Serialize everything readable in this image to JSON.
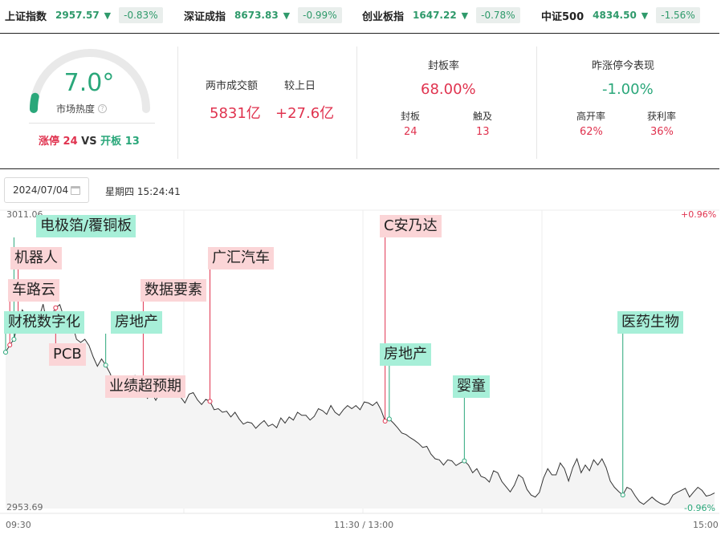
{
  "indices": [
    {
      "name": "上证指数",
      "value": "2957.57",
      "arrow": "▼",
      "pct": "-0.83%"
    },
    {
      "name": "深证成指",
      "value": "8673.83",
      "arrow": "▼",
      "pct": "-0.99%"
    },
    {
      "name": "创业板指",
      "value": "1647.22",
      "arrow": "▼",
      "pct": "-0.78%"
    },
    {
      "name": "中证500",
      "value": "4834.50",
      "arrow": "▼",
      "pct": "-1.56%"
    }
  ],
  "heat": {
    "value": "7.0°",
    "level": 0.07,
    "label": "市场热度",
    "limit_up_label": "涨停",
    "limit_up": "24",
    "vs": "VS",
    "broken_label": "开板",
    "broken": "13"
  },
  "turnover": {
    "label": "两市成交额",
    "value": "5831亿",
    "prev_label": "较上日",
    "prev_value": "+27.6亿"
  },
  "seal": {
    "title": "封板率",
    "rate": "68.00%",
    "sealed_label": "封板",
    "sealed": "24",
    "touched_label": "触及",
    "touched": "13"
  },
  "yesterday": {
    "title": "昨涨停今表现",
    "value": "-1.00%",
    "high_open_label": "高开率",
    "high_open": "62%",
    "profit_label": "获利率",
    "profit": "36%"
  },
  "date": "2024/07/04",
  "weektime": "星期四 15:24:41",
  "colors": {
    "up": "#e0334f",
    "down": "#2aa77a",
    "red_tag": "#fbd5d7",
    "green_tag": "#a7efd8"
  },
  "chart_data": {
    "type": "line",
    "y_top": "3011.06",
    "y_bottom": "2953.69",
    "pct_top": "+0.96%",
    "pct_bottom": "-0.96%",
    "x_labels": [
      "09:30",
      "11:30 / 13:00",
      "15:00"
    ],
    "ylim": [
      2953.69,
      3011.06
    ],
    "series": [
      {
        "values": [
          2983.9,
          2985.3,
          2986.4,
          2990.0,
          2992.1,
          2990.6,
          2991.0,
          2989.9,
          2990.6,
          2993.2,
          2989.3,
          2991.0,
          2992.5,
          2993.1,
          2990.6,
          2989.9,
          2989.4,
          2986.4,
          2985.8,
          2986.4,
          2985.2,
          2983.0,
          2981.2,
          2982.6,
          2981.4,
          2979.9,
          2977.9,
          2979.0,
          2978.2,
          2977.7,
          2978.6,
          2979.4,
          2976.1,
          2976.8,
          2975.0,
          2976.1,
          2974.6,
          2976.1,
          2977.0,
          2977.4,
          2977.4,
          2976.1,
          2975.2,
          2974.1,
          2975.8,
          2976.1,
          2974.7,
          2973.8,
          2974.8,
          2974.4,
          2972.8,
          2973.0,
          2972.3,
          2972.5,
          2971.4,
          2972.3,
          2971.0,
          2970.0,
          2970.4,
          2970.2,
          2969.2,
          2970.0,
          2970.7,
          2969.6,
          2970.0,
          2969.3,
          2971.2,
          2970.2,
          2971.4,
          2970.8,
          2972.3,
          2971.7,
          2971.7,
          2970.8,
          2971.5,
          2973.0,
          2972.6,
          2971.9,
          2973.6,
          2972.3,
          2971.7,
          2972.8,
          2973.6,
          2973.0,
          2973.6,
          2972.8,
          2974.3,
          2974.1,
          2973.6,
          2974.3,
          2972.8,
          2970.6,
          2971.0,
          2970.2,
          2969.3,
          2968.3,
          2968.0,
          2967.4,
          2966.9,
          2966.3,
          2965.5,
          2965.7,
          2964.2,
          2963.3,
          2963.1,
          2962.1,
          2963.1,
          2962.9,
          2962.0,
          2962.5,
          2962.9,
          2962.1,
          2960.6,
          2961.4,
          2959.9,
          2959.6,
          2958.8,
          2961.0,
          2960.6,
          2958.9,
          2957.9,
          2956.9,
          2958.2,
          2960.2,
          2959.6,
          2957.4,
          2956.3,
          2955.9,
          2956.8,
          2959.6,
          2961.4,
          2960.2,
          2960.2,
          2962.5,
          2961.4,
          2959.0,
          2961.6,
          2963.3,
          2960.6,
          2962.1,
          2961.0,
          2963.1,
          2962.1,
          2963.3,
          2961.6,
          2959.0,
          2957.8,
          2957.0,
          2956.3,
          2957.8,
          2957.4,
          2956.1,
          2955.0,
          2954.5,
          2955.2,
          2955.9,
          2955.2,
          2954.7,
          2954.4,
          2954.8,
          2956.3,
          2956.8,
          2957.2,
          2957.6,
          2955.9,
          2956.9,
          2957.8,
          2957.2,
          2956.1,
          2956.3,
          2956.7
        ]
      }
    ]
  },
  "tags": [
    {
      "text": "电极箔/覆铜板",
      "color": "green"
    },
    {
      "text": "机器人",
      "color": "red"
    },
    {
      "text": "车路云",
      "color": "red"
    },
    {
      "text": "财税数字化",
      "color": "green"
    },
    {
      "text": "PCB",
      "color": "red"
    },
    {
      "text": "房地产",
      "color": "green"
    },
    {
      "text": "数据要素",
      "color": "red"
    },
    {
      "text": "业绩超预期",
      "color": "red"
    },
    {
      "text": "广汇汽车",
      "color": "red"
    },
    {
      "text": "C安乃达",
      "color": "red"
    },
    {
      "text": "房地产",
      "color": "green"
    },
    {
      "text": "婴童",
      "color": "green"
    },
    {
      "text": "医药生物",
      "color": "green"
    }
  ]
}
